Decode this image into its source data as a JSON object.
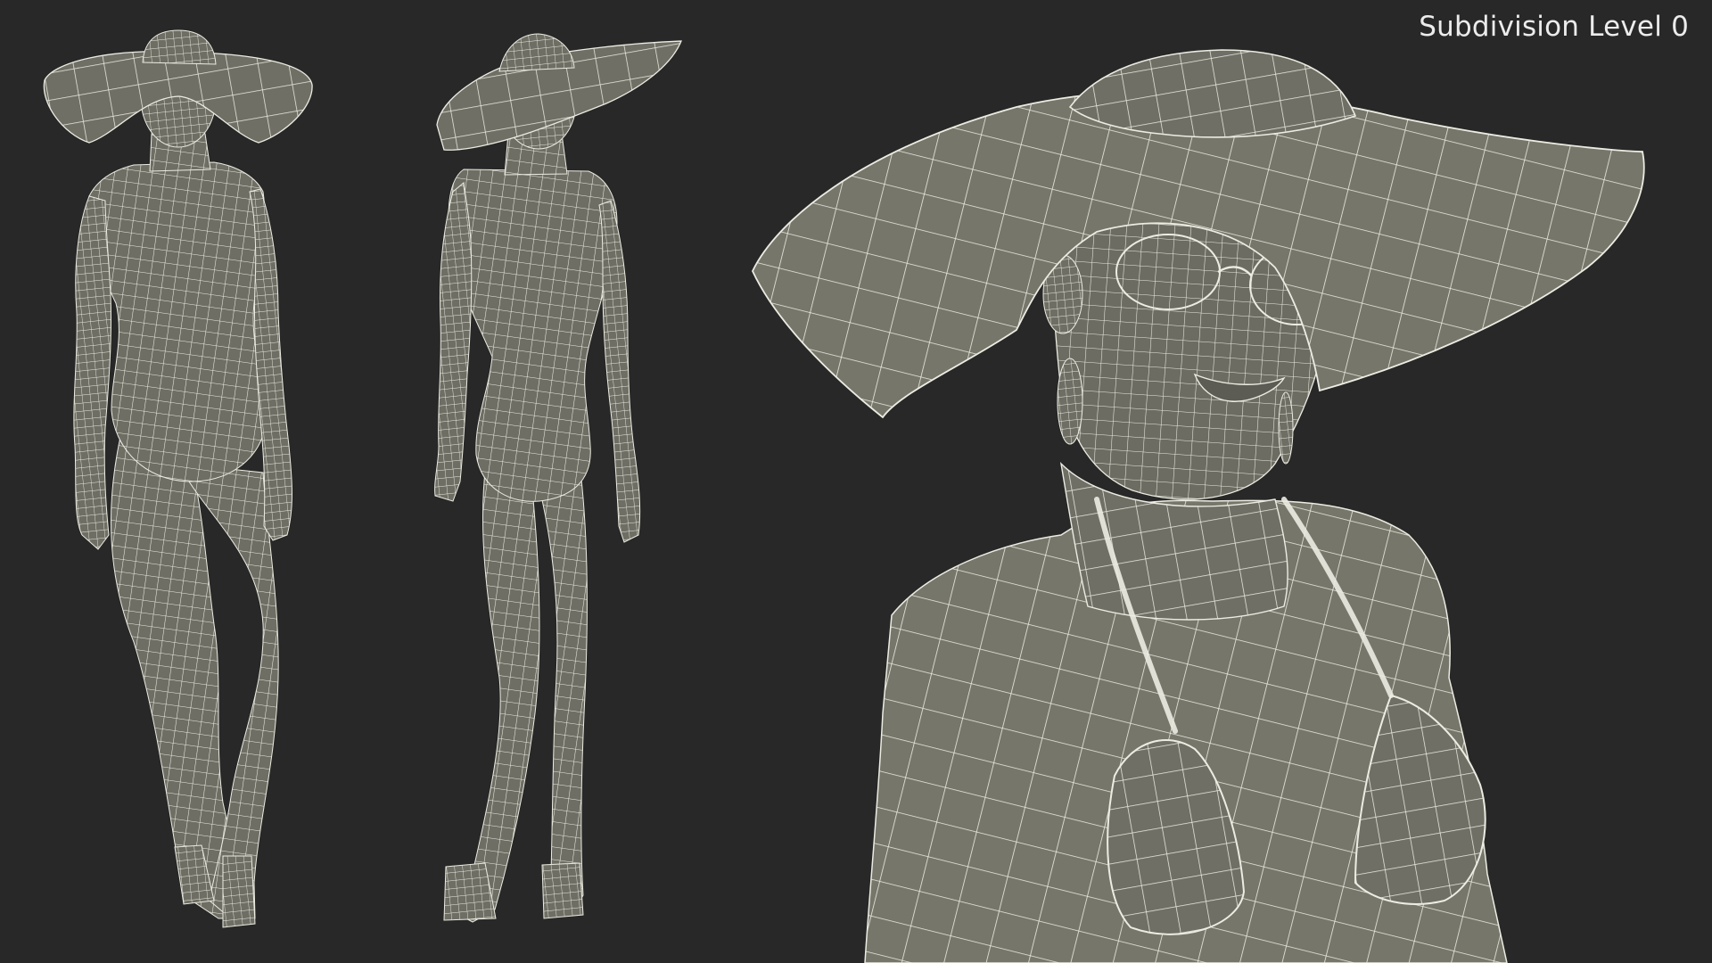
{
  "render": {
    "subdivision_label": "Subdivision Level 0",
    "background_color": "#282828",
    "mesh_fill_color": "#6e6e64",
    "wire_color": "#ecece2"
  },
  "views": [
    {
      "name": "front-view",
      "description_icon": "figure-front"
    },
    {
      "name": "back-view",
      "description_icon": "figure-back"
    },
    {
      "name": "closeup-view",
      "description_icon": "figure-closeup"
    }
  ]
}
